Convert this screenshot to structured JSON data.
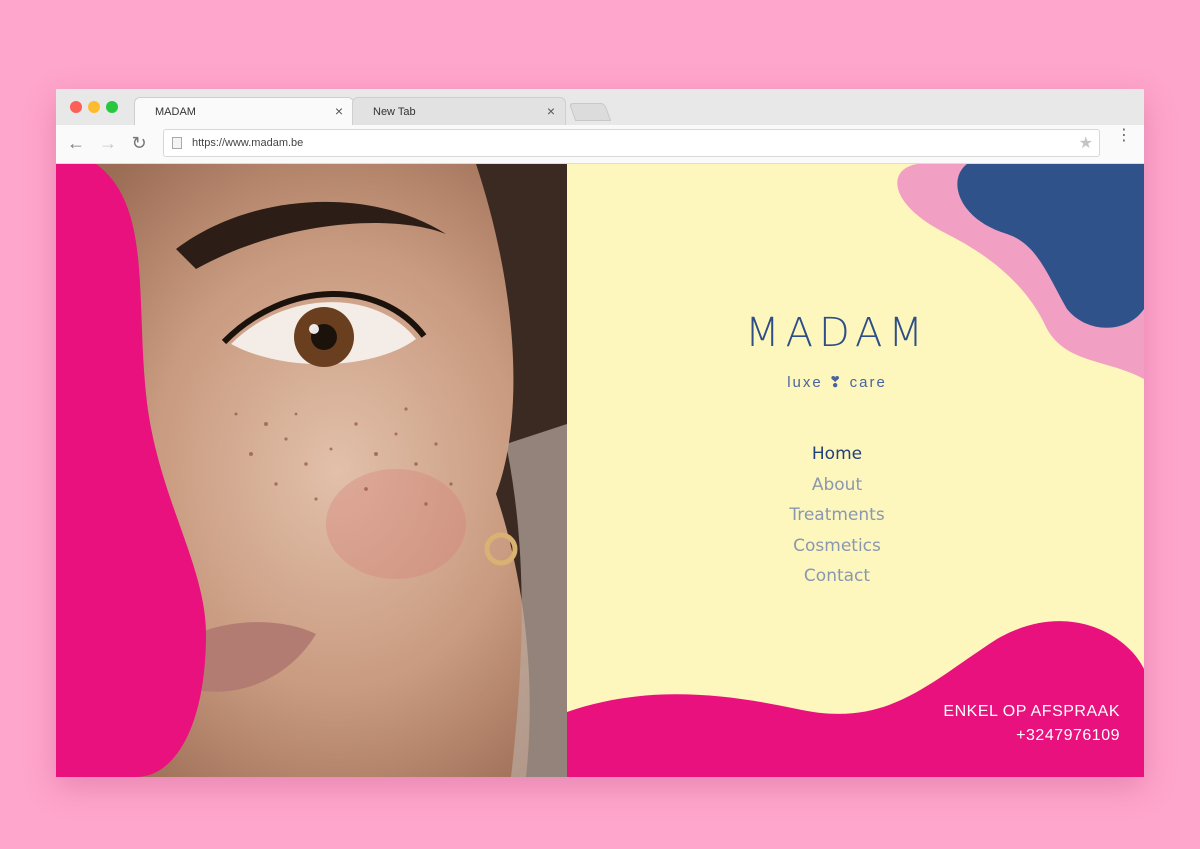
{
  "browser": {
    "tabs": [
      {
        "label": "MADAM",
        "close": "×"
      },
      {
        "label": "New Tab",
        "close": "×"
      }
    ],
    "url": "https://www.madam.be",
    "nav": {
      "back": "←",
      "forward": "→",
      "reload": "↻"
    },
    "star": "★",
    "menu": "⋮"
  },
  "brand": {
    "wordmark": "MADAM",
    "tagline": "luxe ❣ care",
    "colors": {
      "magenta": "#e8117d",
      "navy": "#2d4e86",
      "cream": "#fdf6bd",
      "pink": "#f29fc4"
    }
  },
  "menu_items": [
    {
      "label": "Home",
      "active": true
    },
    {
      "label": "About",
      "active": false
    },
    {
      "label": "Treatments",
      "active": false
    },
    {
      "label": "Cosmetics",
      "active": false
    },
    {
      "label": "Contact",
      "active": false
    }
  ],
  "contact": {
    "line1": "ENKEL OP AFSPRAAK",
    "phone": "+3247976109"
  }
}
